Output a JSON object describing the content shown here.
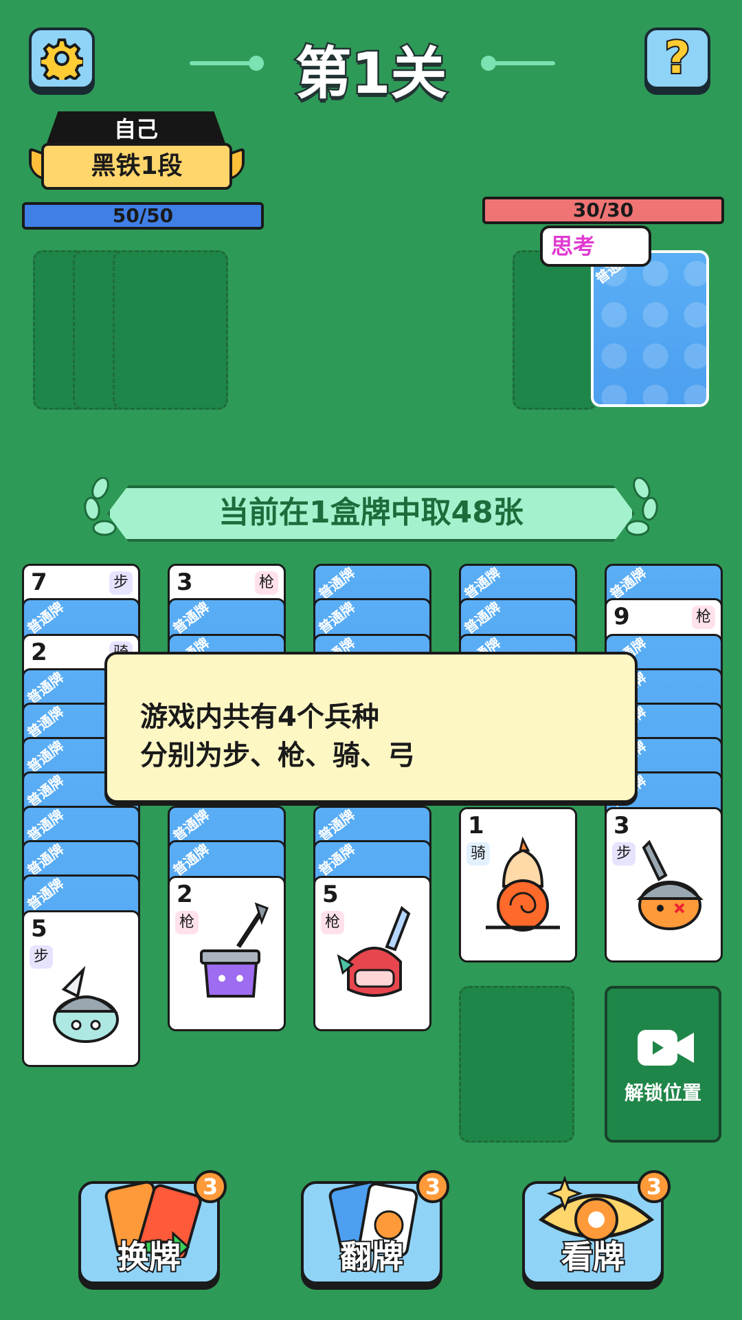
{
  "header": {
    "level_title": "第1关"
  },
  "player": {
    "name": "自己",
    "rank": "黑铁1段",
    "hp": "50/50"
  },
  "opponent": {
    "hp": "30/30",
    "status": "思考"
  },
  "card_back_label": "普通牌",
  "banner": {
    "text": "当前在1盒牌中取48张"
  },
  "columns": [
    {
      "face_cards": [
        {
          "value": "7",
          "unit": "步"
        },
        {
          "value": "2",
          "unit": "骑"
        }
      ],
      "bottom": {
        "value": "5",
        "unit": "步"
      }
    },
    {
      "face_cards": [
        {
          "value": "3",
          "unit": "枪"
        }
      ],
      "bottom": {
        "value": "2",
        "unit": "枪"
      }
    },
    {
      "bottom": {
        "value": "5",
        "unit": "枪"
      }
    },
    {
      "bottom": {
        "value": "1",
        "unit": "骑"
      }
    },
    {
      "face_cards": [
        {
          "value": "9",
          "unit": "枪"
        }
      ],
      "bottom": {
        "value": "3",
        "unit": "步"
      }
    }
  ],
  "tooltip": {
    "line1": "游戏内共有4个兵种",
    "line2": "分别为步、枪、骑、弓"
  },
  "unlock": {
    "label": "解锁位置"
  },
  "tools": [
    {
      "label": "换牌",
      "count": "3"
    },
    {
      "label": "翻牌",
      "count": "3"
    },
    {
      "label": "看牌",
      "count": "3"
    }
  ],
  "colors": {
    "background": "#2e9a57",
    "player_hp": "#3f7fe6",
    "opponent_hp": "#f07474",
    "card_back": "#56a8f0"
  }
}
